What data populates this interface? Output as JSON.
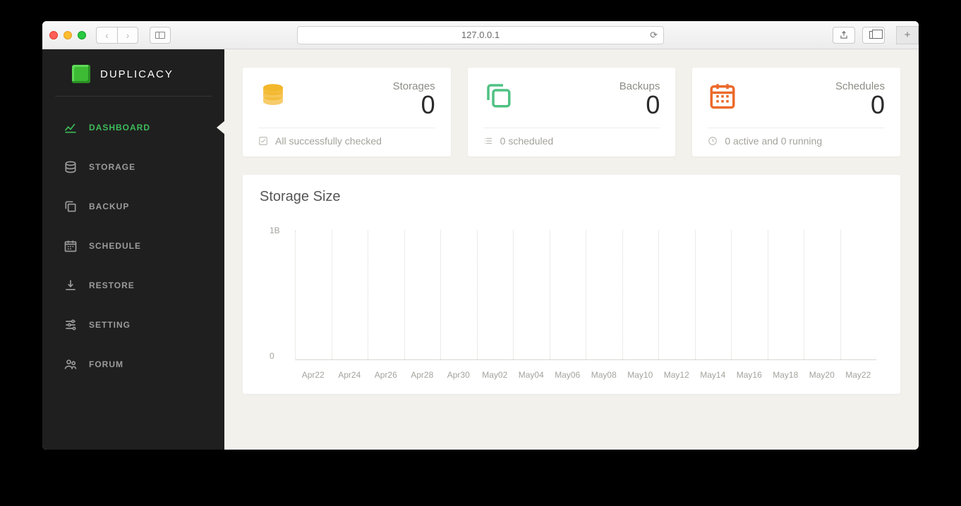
{
  "browser": {
    "url": "127.0.0.1"
  },
  "brand": "DUPLICACY",
  "sidebar": {
    "items": [
      {
        "label": "DASHBOARD",
        "active": true
      },
      {
        "label": "STORAGE"
      },
      {
        "label": "BACKUP"
      },
      {
        "label": "SCHEDULE"
      },
      {
        "label": "RESTORE"
      },
      {
        "label": "SETTING"
      },
      {
        "label": "FORUM"
      }
    ]
  },
  "cards": {
    "storages": {
      "label": "Storages",
      "value": "0",
      "footer": "All successfully checked",
      "accent": "#f3b72b"
    },
    "backups": {
      "label": "Backups",
      "value": "0",
      "footer": "0 scheduled",
      "accent": "#4fc183"
    },
    "schedules": {
      "label": "Schedules",
      "value": "0",
      "footer": "0 active and 0 running",
      "accent": "#ec6a2c"
    }
  },
  "chart": {
    "title": "Storage Size"
  },
  "chart_data": {
    "type": "line",
    "title": "Storage Size",
    "xlabel": "",
    "ylabel": "",
    "categories": [
      "Apr22",
      "Apr24",
      "Apr26",
      "Apr28",
      "Apr30",
      "May02",
      "May04",
      "May06",
      "May08",
      "May10",
      "May12",
      "May14",
      "May16",
      "May18",
      "May20",
      "May22"
    ],
    "y_ticks": [
      "1B",
      "0"
    ],
    "ylim": [
      "0",
      "1B"
    ],
    "series": [
      {
        "name": "size",
        "values": []
      }
    ]
  }
}
